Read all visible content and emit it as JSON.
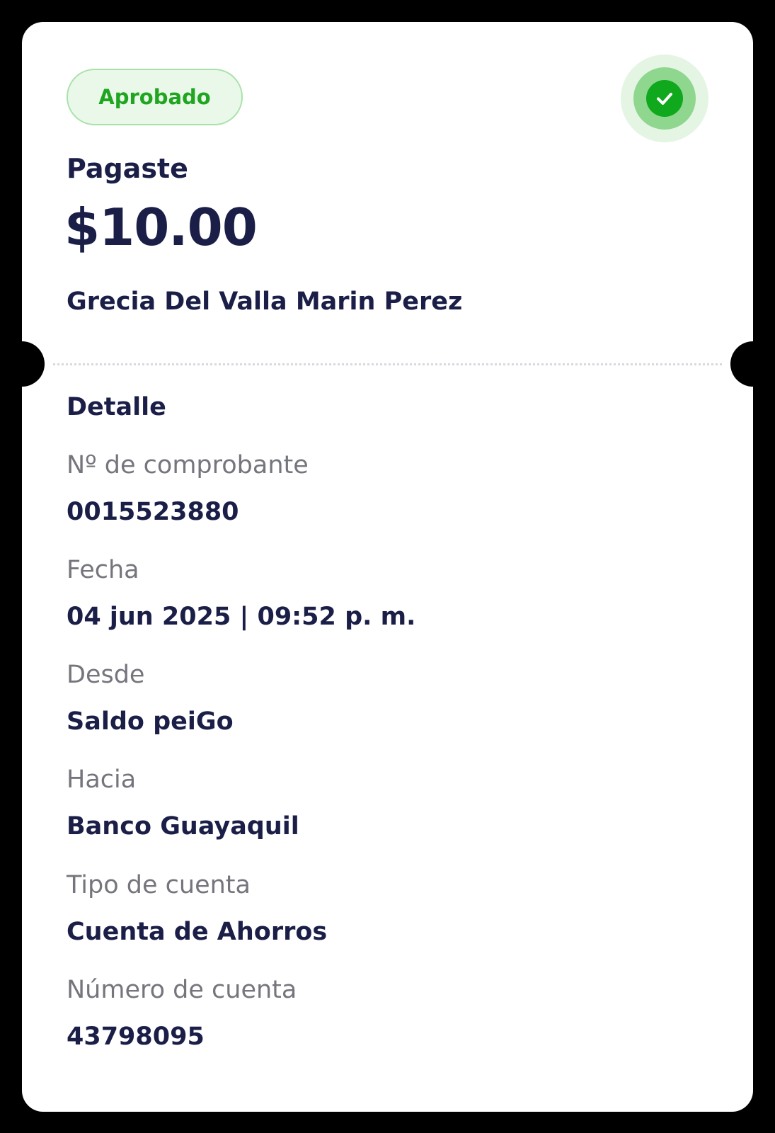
{
  "status": {
    "label": "Aprobado",
    "icon": "check-circle-icon",
    "color": "#1fa51f"
  },
  "payment": {
    "title": "Pagaste",
    "amount": "$10.00",
    "recipient": "Grecia Del Valla Marin Perez"
  },
  "detail": {
    "title": "Detalle",
    "fields": [
      {
        "label": "Nº de comprobante",
        "value": "0015523880"
      },
      {
        "label": "Fecha",
        "value": "04 jun 2025 | 09:52 p. m."
      },
      {
        "label": "Desde",
        "value": "Saldo peiGo"
      },
      {
        "label": "Hacia",
        "value": "Banco Guayaquil"
      },
      {
        "label": "Tipo de cuenta",
        "value": "Cuenta de Ahorros"
      },
      {
        "label": "Número de cuenta",
        "value": "43798095"
      }
    ]
  },
  "colors": {
    "text_primary": "#1b1f48",
    "text_secondary": "#75767d",
    "success": "#10a81c"
  }
}
